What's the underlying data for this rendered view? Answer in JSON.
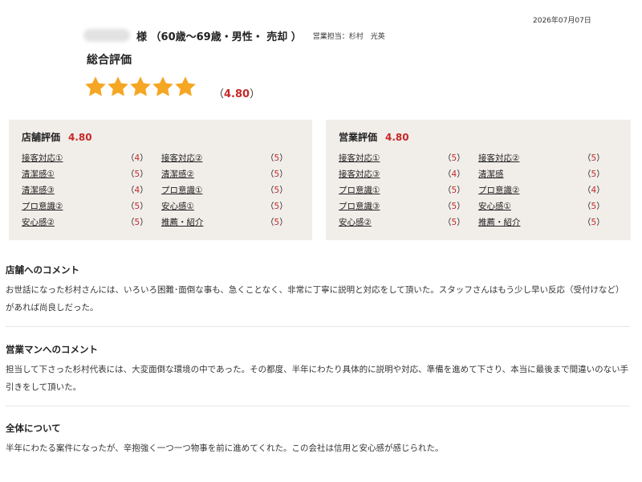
{
  "date": "2026年07月07日",
  "header": {
    "customer_info": "様 （60歳〜69歳・男性・ 売却 ）",
    "staff": "営業担当：杉村　光英"
  },
  "overall": {
    "title": "総合評価",
    "stars": 5,
    "score_open": "（",
    "score": "4.80",
    "score_close": "）",
    "star_color": "#f5a623"
  },
  "store_rating": {
    "title": "店舗評価",
    "score": "4.80",
    "items": [
      {
        "label": "接客対応①",
        "score": "4"
      },
      {
        "label": "接客対応②",
        "score": "5"
      },
      {
        "label": "清潔感①",
        "score": "5"
      },
      {
        "label": "清潔感②",
        "score": "5"
      },
      {
        "label": "清潔感③",
        "score": "4"
      },
      {
        "label": "プロ意識①",
        "score": "5"
      },
      {
        "label": "プロ意識②",
        "score": "5"
      },
      {
        "label": "安心感①",
        "score": "5"
      },
      {
        "label": "安心感②",
        "score": "5"
      },
      {
        "label": "推薦・紹介",
        "score": "5"
      }
    ]
  },
  "sales_rating": {
    "title": "営業評価",
    "score": "4.80",
    "items": [
      {
        "label": "接客対応①",
        "score": "5"
      },
      {
        "label": "接客対応②",
        "score": "5"
      },
      {
        "label": "接客対応③",
        "score": "4"
      },
      {
        "label": "清潔感",
        "score": "5"
      },
      {
        "label": "プロ意識①",
        "score": "5"
      },
      {
        "label": "プロ意識②",
        "score": "4"
      },
      {
        "label": "プロ意識③",
        "score": "5"
      },
      {
        "label": "安心感①",
        "score": "5"
      },
      {
        "label": "安心感②",
        "score": "5"
      },
      {
        "label": "推薦・紹介",
        "score": "5"
      }
    ]
  },
  "comments": {
    "store": {
      "title": "店舗へのコメント",
      "text": "お世話になった杉村さんには、いろいろ困難･面倒な事も、急くことなく、非常に丁寧に説明と対応をして頂いた。スタッフさんはもう少し早い反応（受付けなど）があれば尚良しだった。"
    },
    "sales": {
      "title": "営業マンへのコメント",
      "text": "担当して下さった杉村代表には、大変面倒な環境の中であった。その都度、半年にわたり具体的に説明や対応、準備を進めて下さり、本当に最後まで間違いのない手引きをして頂いた。"
    },
    "overall": {
      "title": "全体について",
      "text": "半年にわたる案件になったが、辛抱強く一つ一つ物事を前に進めてくれた。この会社は信用と安心感が感じられた。"
    }
  },
  "colors": {
    "accent_red": "#c62828",
    "panel_bg": "#f1eeea"
  }
}
